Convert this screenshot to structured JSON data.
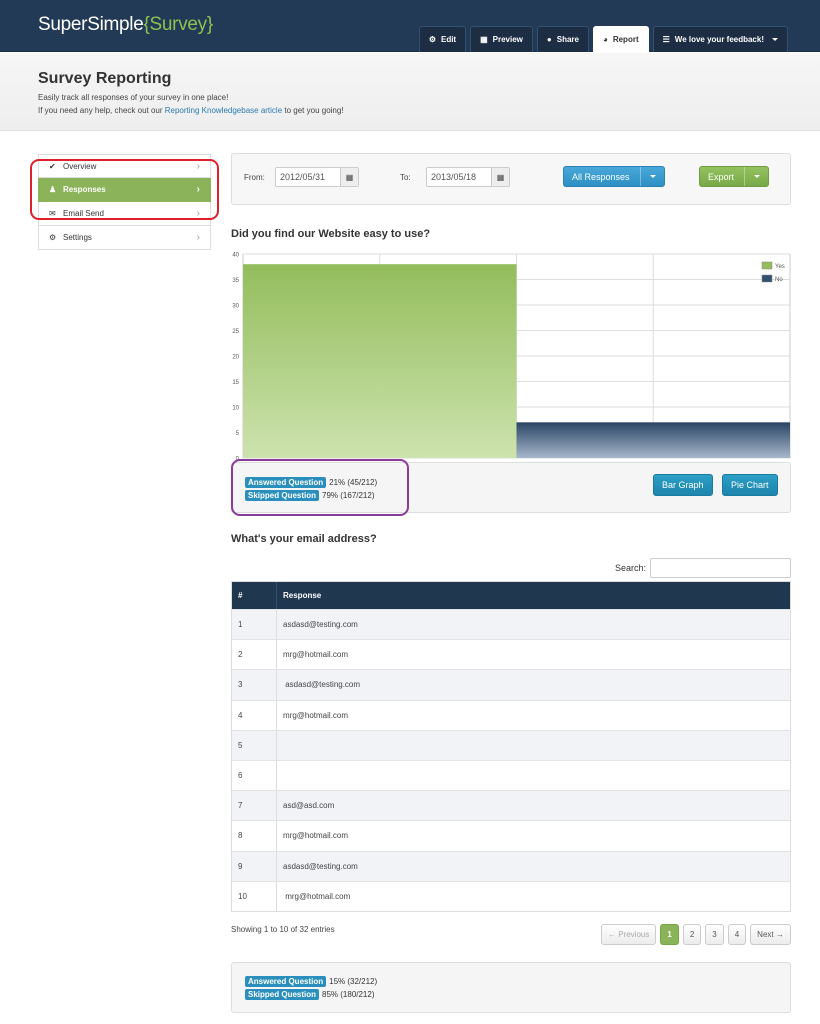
{
  "app": {
    "logo_main": "SuperSimple",
    "logo_brace": "{Survey}",
    "brand_color": "#8cc152",
    "nav": [
      {
        "label": "Edit",
        "icon": "gear-icon"
      },
      {
        "label": "Preview",
        "icon": "film-icon"
      },
      {
        "label": "Share",
        "icon": "globe-icon"
      },
      {
        "label": "Report",
        "icon": "dashboard-icon",
        "active": true
      },
      {
        "label": "We love your feedback!",
        "icon": "list-icon",
        "dropdown": true
      }
    ]
  },
  "header": {
    "title": "Survey Reporting",
    "line1": "Easily track all responses of your survey in one place!",
    "line2_pre": "If you need any help, check out our ",
    "line2_link": "Reporting Knowledgebase article",
    "line2_post": " to get you going!"
  },
  "sidebar": {
    "items": [
      {
        "label": "Overview",
        "icon": "check-icon"
      },
      {
        "label": "Responses",
        "icon": "user-icon",
        "active": true
      },
      {
        "label": "Email Send",
        "icon": "envelope-icon"
      },
      {
        "label": "Settings",
        "icon": "gear-icon"
      }
    ]
  },
  "filters": {
    "from_label": "From:",
    "from_value": "2012/05/31",
    "to_label": "To:",
    "to_value": "2013/05/18",
    "responses_button": "All Responses",
    "export_button": "Export"
  },
  "question1": {
    "title": "Did you find our Website easy to use?",
    "answered_label": "Answered Question",
    "answered_value": "21% (45/212)",
    "skipped_label": "Skipped Question",
    "skipped_value": "79% (167/212)",
    "bar_button": "Bar Graph",
    "pie_button": "Pie Chart"
  },
  "chart_data": {
    "type": "bar",
    "categories": [
      "Yes",
      "No"
    ],
    "values": [
      38,
      7
    ],
    "series": [
      {
        "name": "Yes",
        "values": [
          38
        ],
        "color": "#93bd5c"
      },
      {
        "name": "No",
        "values": [
          7
        ],
        "color": "#34506f"
      }
    ],
    "ylim": [
      0,
      40
    ],
    "yticks": [
      "0",
      "5",
      "10",
      "15",
      "20",
      "25",
      "30",
      "35",
      "40"
    ],
    "grid": true,
    "legend": "top-right"
  },
  "question2": {
    "title": "What's your email address?",
    "search_label": "Search:",
    "columns": [
      "#",
      "Response"
    ],
    "rows": [
      {
        "n": "1",
        "response": "asdasd@testing.com"
      },
      {
        "n": "2",
        "response": "mrg@hotmail.com"
      },
      {
        "n": "3",
        "response": " asdasd@testing.com"
      },
      {
        "n": "4",
        "response": "mrg@hotmail.com"
      },
      {
        "n": "5",
        "response": ""
      },
      {
        "n": "6",
        "response": ""
      },
      {
        "n": "7",
        "response": "asd@asd.com"
      },
      {
        "n": "8",
        "response": "mrg@hotmail.com"
      },
      {
        "n": "9",
        "response": "asdasd@testing.com"
      },
      {
        "n": "10",
        "response": " mrg@hotmail.com"
      }
    ],
    "showing": "Showing 1 to 10 of 32 entries",
    "pager": {
      "prev": "← Previous",
      "pages": [
        "1",
        "2",
        "3",
        "4"
      ],
      "current": "1",
      "next": "Next →"
    },
    "answered_label": "Answered Question",
    "answered_value": "15% (32/212)",
    "skipped_label": "Skipped Question",
    "skipped_value": "85% (180/212)"
  }
}
